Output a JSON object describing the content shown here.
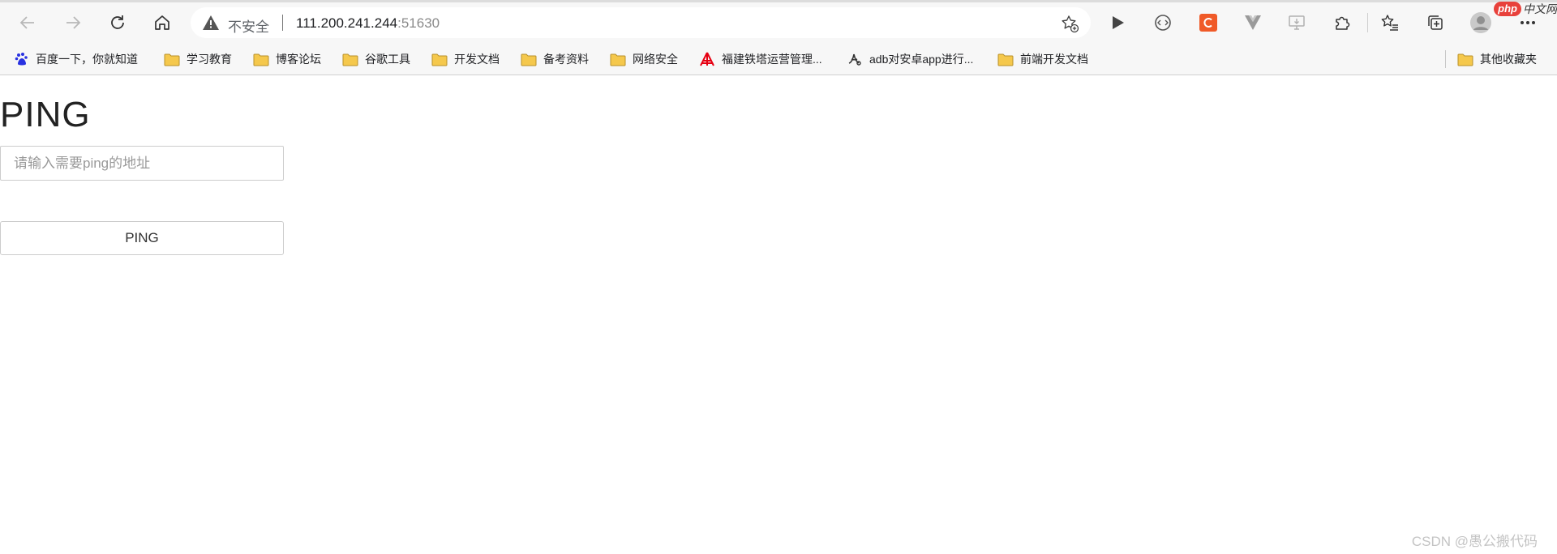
{
  "browser": {
    "address_bar": {
      "security_label": "不安全",
      "url_host": "111.200.241.244",
      "url_port": ":51630"
    },
    "bookmarks": [
      {
        "label": "百度一下，你就知道",
        "icon": "baidu-icon"
      },
      {
        "label": "学习教育",
        "icon": "folder-icon"
      },
      {
        "label": "博客论坛",
        "icon": "folder-icon"
      },
      {
        "label": "谷歌工具",
        "icon": "folder-icon"
      },
      {
        "label": "开发文档",
        "icon": "folder-icon"
      },
      {
        "label": "备考资料",
        "icon": "folder-icon"
      },
      {
        "label": "网络安全",
        "icon": "folder-icon"
      },
      {
        "label": "福建铁塔运营管理...",
        "icon": "tower-icon"
      },
      {
        "label": "adb对安卓app进行...",
        "icon": "adb-icon"
      },
      {
        "label": "前端开发文档",
        "icon": "folder-icon"
      }
    ],
    "other_bookmarks": "其他收藏夹",
    "colors": {
      "folder": "#f5c84c",
      "orange_ext": "#f05a28",
      "baidu": "#2932e1",
      "tower": "#e60012"
    }
  },
  "watermark": {
    "badge": "php",
    "text": "中文网"
  },
  "page": {
    "title": "PING",
    "input_placeholder": "请输入需要ping的地址",
    "input_value": "",
    "button_label": "PING"
  },
  "credit": "CSDN @愚公搬代码"
}
